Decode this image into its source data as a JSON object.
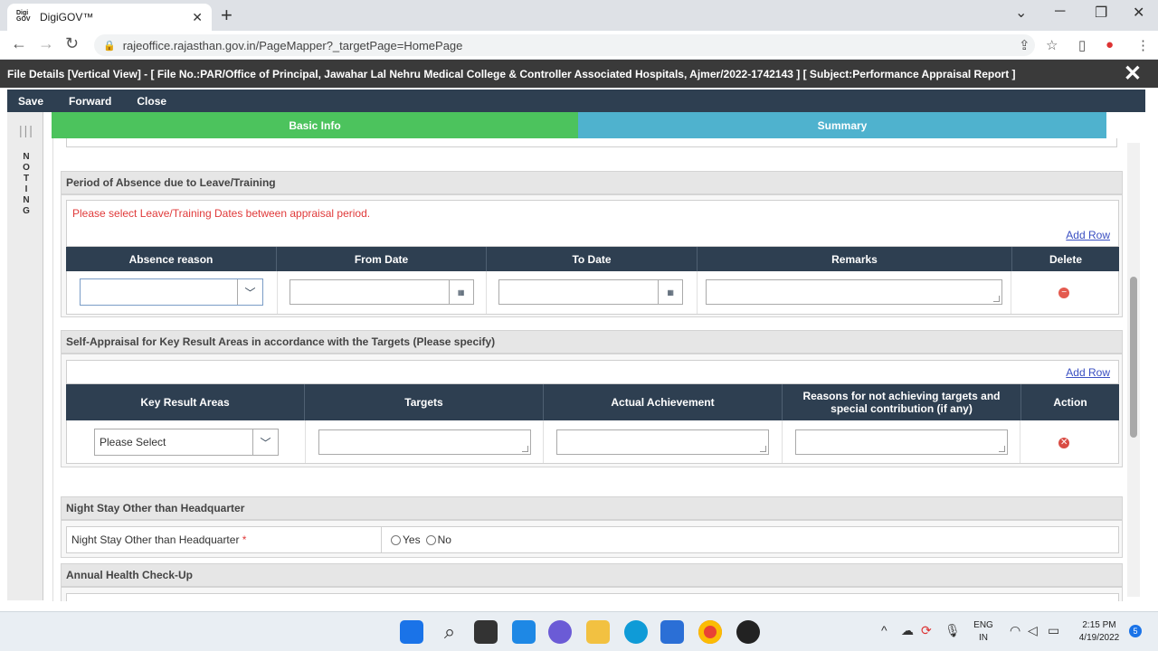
{
  "browser": {
    "tab_title": "DigiGOV™",
    "favicon_text": "Digi GOV",
    "url": "rajeoffice.rajasthan.gov.in/PageMapper?_targetPage=HomePage"
  },
  "file_header": {
    "title": "File Details [Vertical View] - [ File No.:PAR/Office of Principal, Jawahar Lal Nehru Medical College & Controller Associated Hospitals, Ajmer/2022-1742143 ] [ Subject:Performance Appraisal Report ]"
  },
  "toolbar": {
    "save": "Save",
    "forward": "Forward",
    "close": "Close"
  },
  "side": {
    "noting": "N O T I N G"
  },
  "tabs": {
    "basic_info": "Basic Info",
    "summary": "Summary"
  },
  "absence": {
    "title": "Period of Absence due to Leave/Training",
    "error": "Please select Leave/Training Dates between appraisal period.",
    "add_row": "Add Row",
    "columns": [
      "Absence reason",
      "From Date",
      "To Date",
      "Remarks",
      "Delete"
    ],
    "row": {
      "reason": "",
      "from": "",
      "to": "",
      "remarks": ""
    }
  },
  "kra": {
    "title": "Self-Appraisal for Key Result Areas in accordance with the Targets (Please specify)",
    "add_row": "Add Row",
    "columns": [
      "Key Result Areas",
      "Targets",
      "Actual Achievement",
      "Reasons for not achieving targets and special contribution (if any)",
      "Action"
    ],
    "row": {
      "kra_select": "Please Select"
    }
  },
  "night_stay": {
    "title": "Night Stay Other than Headquarter",
    "label": "Night Stay Other than Headquarter",
    "required": "*",
    "yes": "Yes",
    "no": "No"
  },
  "health": {
    "title": "Annual Health Check-Up"
  },
  "tray": {
    "lang_top": "ENG",
    "lang_bottom": "IN",
    "time": "2:15 PM",
    "date": "4/19/2022",
    "notif_count": "5"
  }
}
